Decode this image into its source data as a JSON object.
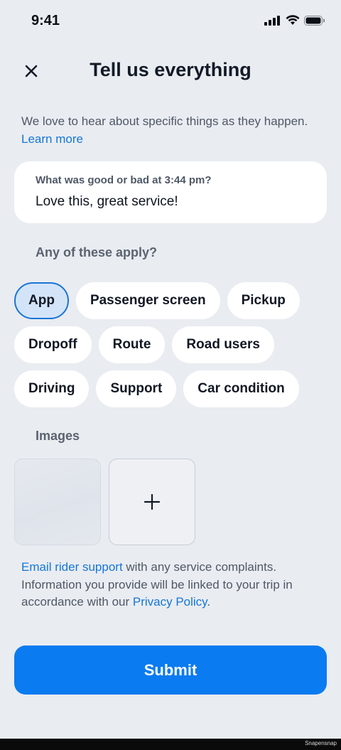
{
  "status_bar": {
    "time": "9:41",
    "icons": [
      "signal-icon",
      "wifi-icon",
      "battery-icon"
    ]
  },
  "header": {
    "close_icon": "close-icon",
    "title": "Tell us everything"
  },
  "intro": {
    "text": "We love to hear about specific things as they happen.",
    "link": "Learn more"
  },
  "feedback": {
    "label": "What was good or bad at 3:44 pm?",
    "value": "Love this, great service!"
  },
  "categories": {
    "label": "Any of these apply?",
    "chips": [
      {
        "label": "App",
        "selected": true
      },
      {
        "label": "Passenger screen",
        "selected": false
      },
      {
        "label": "Pickup",
        "selected": false
      },
      {
        "label": "Dropoff",
        "selected": false
      },
      {
        "label": "Route",
        "selected": false
      },
      {
        "label": "Road users",
        "selected": false
      },
      {
        "label": "Driving",
        "selected": false
      },
      {
        "label": "Support",
        "selected": false
      },
      {
        "label": "Car condition",
        "selected": false
      }
    ]
  },
  "images": {
    "label": "Images",
    "add_icon": "plus-icon"
  },
  "disclaimer": {
    "link1": "Email rider support",
    "text1": "with any service complaints. Information you provide will be linked to your trip in accordance with our",
    "link2": "Privacy Policy",
    "text2": "."
  },
  "submit_label": "Submit",
  "watermark": "Snapensnap",
  "colors": {
    "background": "#e9ecf1",
    "accent": "#0a7bf0",
    "link": "#1577d6",
    "selected_chip_bg": "#d3e4f8"
  }
}
